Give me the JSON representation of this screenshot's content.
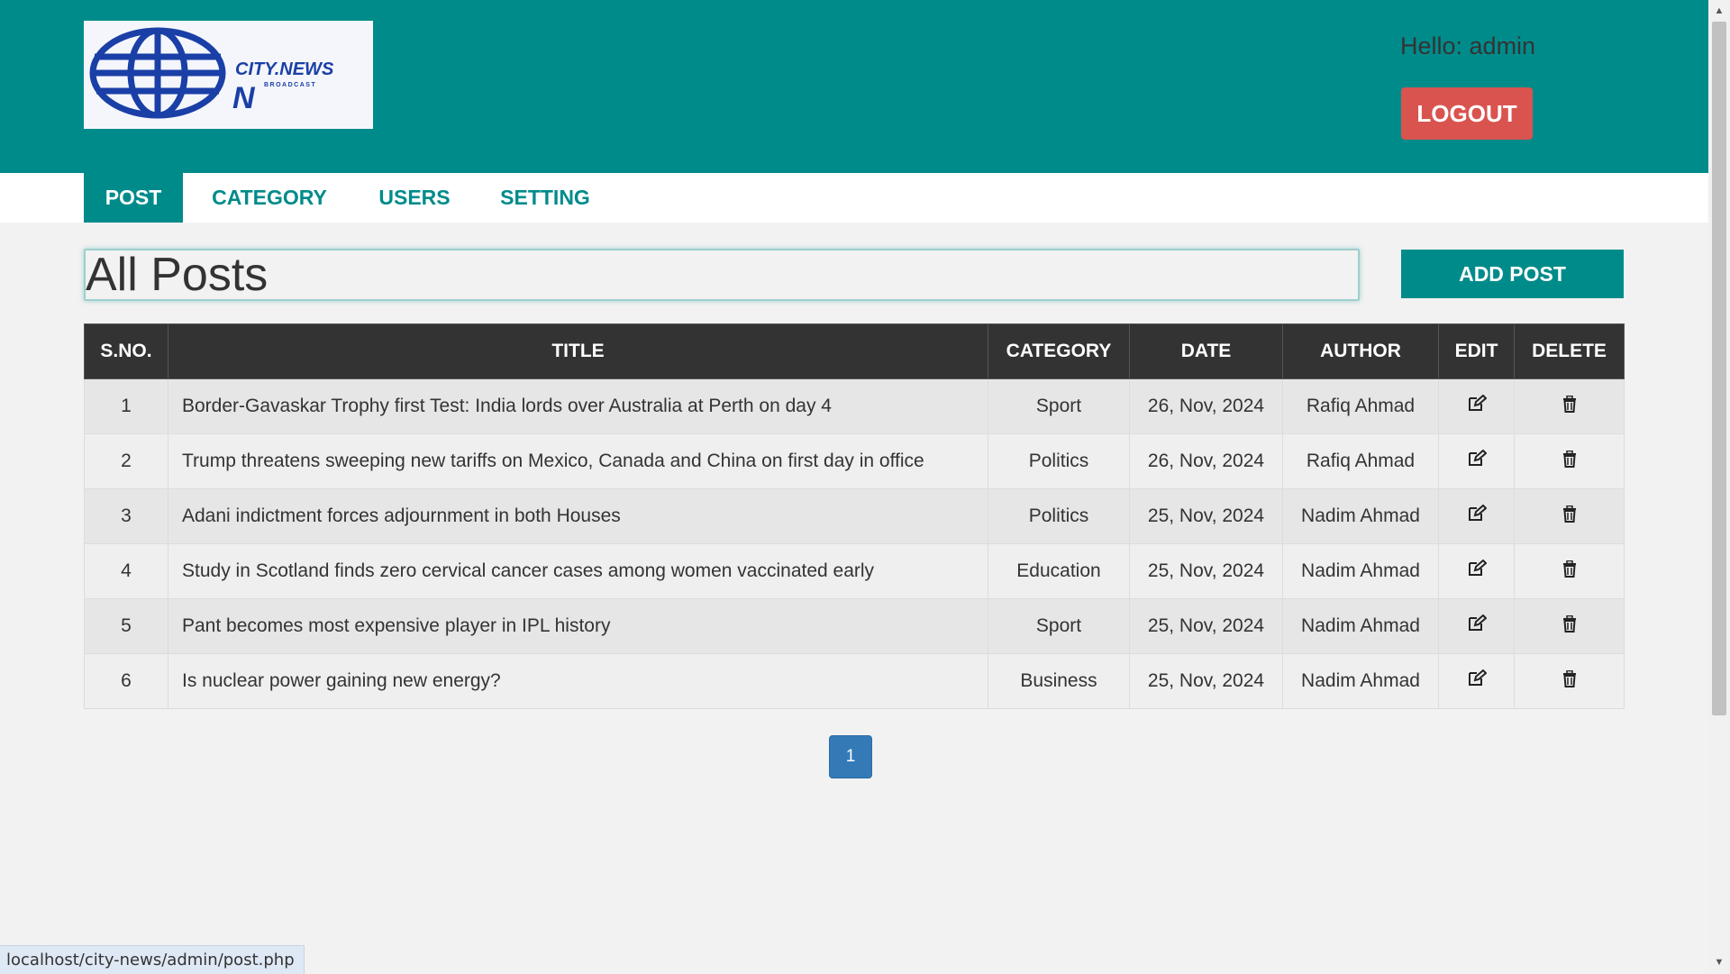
{
  "logo": {
    "text": "CITY.NEWS",
    "subtext": "BROADCAST",
    "icon": "globe-logo-icon"
  },
  "header": {
    "greeting": "Hello: admin",
    "logout_label": "LOGOUT"
  },
  "nav": {
    "items": [
      {
        "label": "POST",
        "active": true
      },
      {
        "label": "CATEGORY",
        "active": false
      },
      {
        "label": "USERS",
        "active": false
      },
      {
        "label": "SETTING",
        "active": false
      }
    ]
  },
  "page": {
    "title": "All Posts",
    "add_post_label": "ADD POST"
  },
  "table": {
    "headers": [
      "S.NO.",
      "TITLE",
      "CATEGORY",
      "DATE",
      "AUTHOR",
      "EDIT",
      "DELETE"
    ],
    "rows": [
      {
        "sno": "1",
        "title": "Border-Gavaskar Trophy first Test: India lords over Australia at Perth on day 4",
        "category": "Sport",
        "date": "26, Nov, 2024",
        "author": "Rafiq Ahmad"
      },
      {
        "sno": "2",
        "title": "Trump threatens sweeping new tariffs on Mexico, Canada and China on first day in office",
        "category": "Politics",
        "date": "26, Nov, 2024",
        "author": "Rafiq Ahmad"
      },
      {
        "sno": "3",
        "title": "Adani indictment forces adjournment in both Houses",
        "category": "Politics",
        "date": "25, Nov, 2024",
        "author": "Nadim Ahmad"
      },
      {
        "sno": "4",
        "title": "Study in Scotland finds zero cervical cancer cases among women vaccinated early",
        "category": "Education",
        "date": "25, Nov, 2024",
        "author": "Nadim Ahmad"
      },
      {
        "sno": "5",
        "title": "Pant becomes most expensive player in IPL history",
        "category": "Sport",
        "date": "25, Nov, 2024",
        "author": "Nadim Ahmad"
      },
      {
        "sno": "6",
        "title": "Is nuclear power gaining new energy?",
        "category": "Business",
        "date": "25, Nov, 2024",
        "author": "Nadim Ahmad"
      }
    ],
    "edit_icon": "edit-icon",
    "delete_icon": "trash-icon"
  },
  "pagination": {
    "current": "1"
  },
  "status_bar": {
    "url": "localhost/city-news/admin/post.php"
  },
  "colors": {
    "header_bg": "#008b8b",
    "logout_bg": "#d9534f",
    "table_header_bg": "#333333",
    "page_btn_bg": "#337ab7"
  }
}
